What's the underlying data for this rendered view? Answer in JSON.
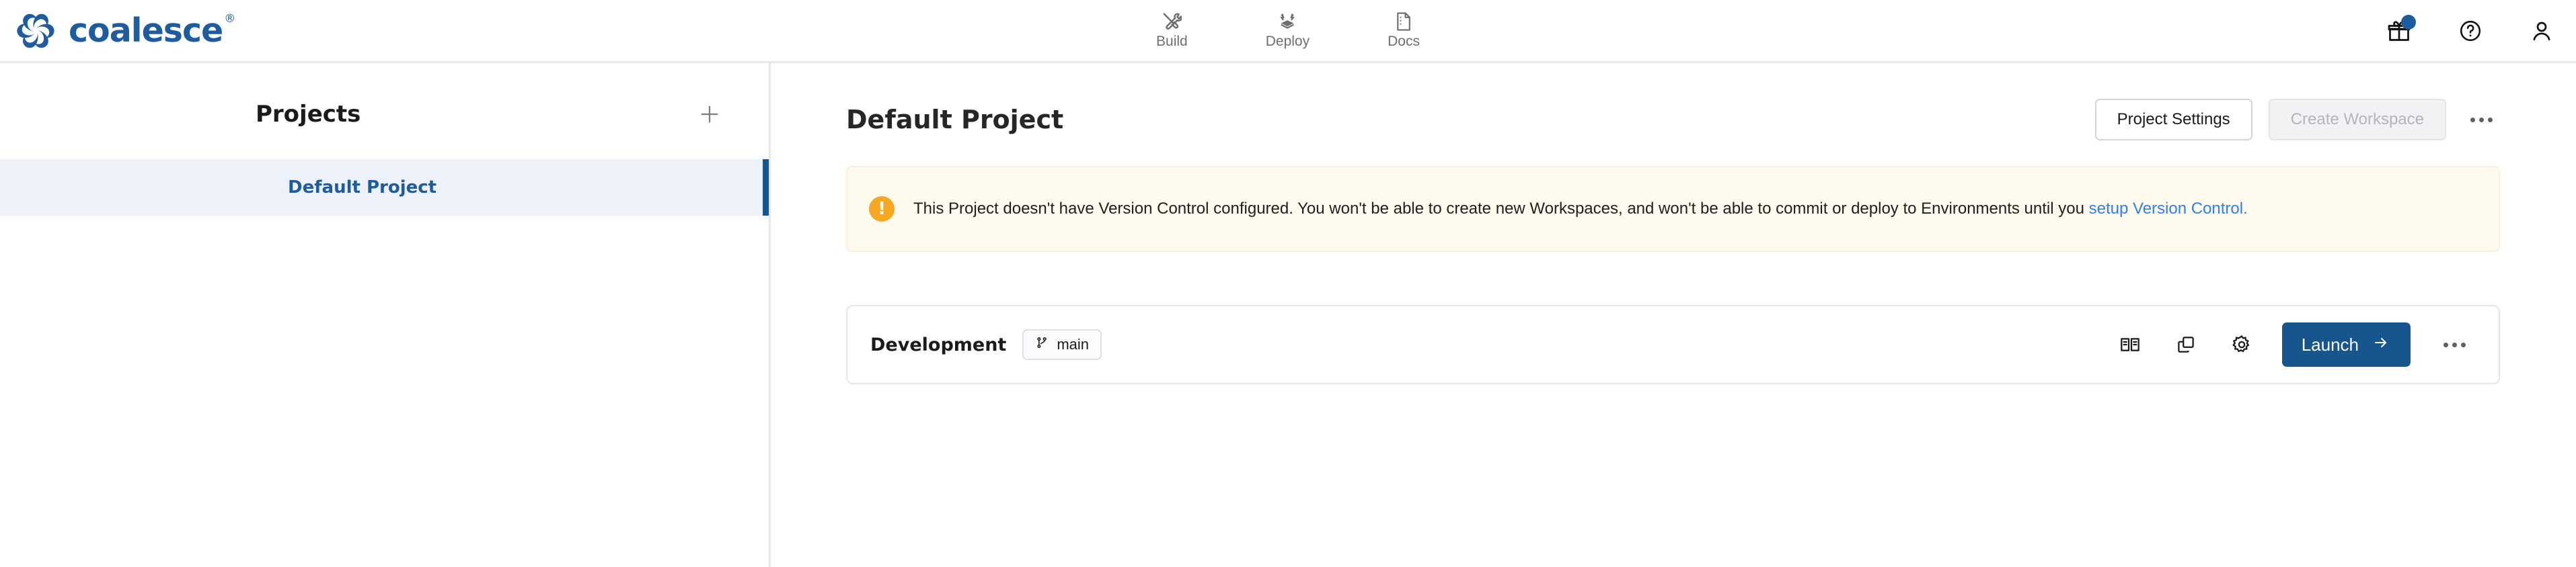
{
  "brand": {
    "name": "coalesce",
    "registered_mark": "®",
    "logo_icon": "coalesce-pinwheel-logo",
    "color": "#1f5c9e"
  },
  "header": {
    "nav": [
      {
        "label": "Build",
        "icon": "tools-icon"
      },
      {
        "label": "Deploy",
        "icon": "deploy-box-icon"
      },
      {
        "label": "Docs",
        "icon": "document-icon"
      }
    ],
    "actions": [
      {
        "name": "gift-icon",
        "has_badge": true,
        "badge_color": "#1f5c9e"
      },
      {
        "name": "help-icon",
        "has_badge": false
      },
      {
        "name": "user-account-icon",
        "has_badge": false
      }
    ]
  },
  "sidebar": {
    "title": "Projects",
    "add_icon": "plus-icon",
    "items": [
      {
        "label": "Default Project",
        "selected": true
      }
    ],
    "selected_bg": "#edf1fa",
    "selected_accent": "#17558e"
  },
  "main": {
    "page_title": "Default Project",
    "actions": {
      "project_settings_label": "Project Settings",
      "create_workspace_label": "Create Workspace",
      "create_workspace_disabled": true,
      "overflow_icon": "kebab-menu-icon"
    },
    "banner": {
      "icon": "warning-exclamation-icon",
      "icon_color": "#f7a823",
      "background": "#fefaed",
      "text_part_1": "This Project doesn't have Version Control configured. You won't be able to create new Workspaces, and won't be able to commit or deploy to Environments until you ",
      "link_text": "setup Version Control.",
      "link_color": "#2f80ed"
    },
    "workspace": {
      "name": "Development",
      "branch_icon": "git-branch-icon",
      "branch": "main",
      "tools": [
        {
          "name": "docs-book-icon"
        },
        {
          "name": "duplicate-copy-icon"
        },
        {
          "name": "settings-gear-icon"
        }
      ],
      "launch_label": "Launch",
      "launch_icon": "arrow-right-icon",
      "launch_color": "#17558e",
      "overflow_icon": "kebab-menu-icon"
    }
  }
}
